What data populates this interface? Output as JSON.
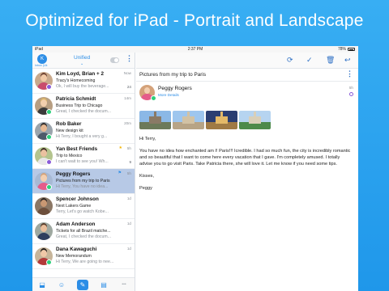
{
  "banner": {
    "title": "Optimized for iPad - Portrait and Landscape"
  },
  "status_bar": {
    "carrier": "iPad",
    "time": "2:37 PM",
    "battery": "78%"
  },
  "left_header": {
    "inbox_label": "Inbox (Uk",
    "folder_label": "Unified",
    "account_initial": "K"
  },
  "mail_list": [
    {
      "sender": "Kim Loyd, Brian + 2",
      "subject": "Tracy's Homecoming",
      "preview": "Ok, I will buy the beverage...",
      "time": "Now",
      "badge": "24",
      "selected": false,
      "account_color": "#8a5bd8",
      "skin": "#f1c9a6",
      "hair": "#6b4030",
      "shirt": "#c94b6d",
      "bg": "#c9a98c",
      "mark": ""
    },
    {
      "sender": "Patricia Schmidt",
      "subject": "Business Trip to Chicago",
      "preview": "Great, I checked the docum...",
      "time": "14m",
      "badge": "",
      "selected": false,
      "account_color": "#2dcf7c",
      "skin": "#f2cfae",
      "hair": "#d9b46a",
      "shirt": "#3a3a3a",
      "bg": "#b79e82",
      "mark": ""
    },
    {
      "sender": "Rob Baker",
      "subject": "New design kit",
      "preview": "Hi Terry, I bought a very g...",
      "time": "20m",
      "badge": "",
      "selected": false,
      "account_color": "#2dcf7c",
      "skin": "#e6b892",
      "hair": "#2e2a28",
      "shirt": "#4d5a6a",
      "bg": "#9aa4ac",
      "mark": ""
    },
    {
      "sender": "Yan Best Friends",
      "subject": "Trip to Mexico",
      "preview": "I can't wait to see you! Wh...",
      "time": "5h",
      "badge": "9",
      "selected": false,
      "account_color": "#8a5bd8",
      "skin": "#eac1a0",
      "hair": "#3b2a22",
      "shirt": "#e8e8e8",
      "bg": "#b4c48e",
      "mark": "star"
    },
    {
      "sender": "Peggy Rogers",
      "subject": "Pictures from my trip to Paris",
      "preview": "Hi Terry, You have no idea...",
      "time": "5h",
      "badge": "",
      "selected": true,
      "account_color": "#2dcf7c",
      "skin": "#f3cfb0",
      "hair": "#d4a27a",
      "shirt": "#e55c8a",
      "bg": "#a7b9d4",
      "mark": "flag"
    },
    {
      "sender": "Spencer Johnson",
      "subject": "Next Lakers Game",
      "preview": "Terry, Let's go watch Kobe...",
      "time": "1d",
      "badge": "",
      "selected": false,
      "account_color": "",
      "skin": "#c99873",
      "hair": "#2a2220",
      "shirt": "#6d4f3c",
      "bg": "#8b7765",
      "mark": ""
    },
    {
      "sender": "Adam Anderson",
      "subject": "Tickets for all Brazil matche...",
      "preview": "Great, I checked the docum...",
      "time": "1d",
      "badge": "",
      "selected": false,
      "account_color": "",
      "skin": "#e9be9b",
      "hair": "#5a3d2b",
      "shirt": "#2f3f5f",
      "bg": "#9ea8a0",
      "mark": ""
    },
    {
      "sender": "Dana Kawaguchi",
      "subject": "New Memorandum",
      "preview": "Hi Terry, We are going to nee...",
      "time": "1d",
      "badge": "",
      "selected": false,
      "account_color": "#2dcf7c",
      "skin": "#f0c8a8",
      "hair": "#1f1a18",
      "shirt": "#b33a3a",
      "bg": "#c7b59a",
      "mark": ""
    }
  ],
  "tab_bar": {
    "icons": [
      "inbox-tray-icon",
      "contacts-icon",
      "compose-icon",
      "clipboard-icon",
      "more-icon"
    ],
    "glyphs": [
      "⬓",
      "☺",
      "✎",
      "▤",
      "•••"
    ]
  },
  "toolbar": {
    "icons": [
      "refresh-icon",
      "check-icon",
      "trash-icon",
      "reply-all-icon"
    ],
    "glyphs": [
      "⟳",
      "✓",
      "🗑",
      "↩"
    ]
  },
  "message": {
    "subject": "Pictures from my trip to Paris",
    "sender_name": "Peggy Rogers",
    "more_details": "More Details",
    "time": "5h",
    "greeting": "Hi Terry,",
    "body": "You have no idea how enchanted am I! Paris!!! Icredible. I had so much fun, the city is incredibly romantic and so beautiful that I want to come here every vacation that I gave. I'm completely amused. I totally advise you to go visit Paris. Take Patricia there, she will love it. Let me know if you need some tips.",
    "closing": "Kisses,",
    "signature": "Peggy",
    "attachments": [
      {
        "name": "paris-photo-1",
        "sky": "#8bb8e6",
        "land": "#6c7a5a",
        "bldg": "#8a7a66"
      },
      {
        "name": "paris-photo-2",
        "sky": "#9ec6ee",
        "land": "#b7a486",
        "bldg": "#d2c2a4"
      },
      {
        "name": "paris-photo-3",
        "sky": "#2b3e72",
        "land": "#a07a44",
        "bldg": "#e4b968"
      },
      {
        "name": "paris-photo-4",
        "sky": "#b6d4f0",
        "land": "#4d8a4a",
        "bldg": "#d9cfb8"
      }
    ]
  }
}
